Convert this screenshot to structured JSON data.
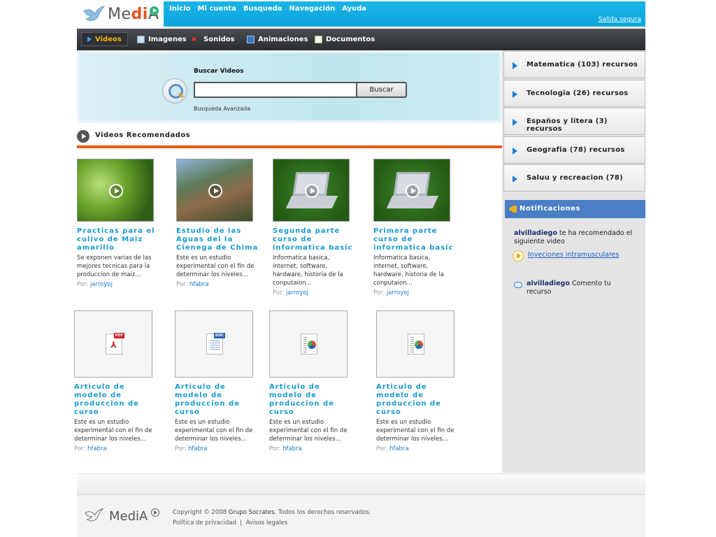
{
  "brand": {
    "name_prefix": "Me",
    "name_accent": "di",
    "name_suffix": "A"
  },
  "topnav": {
    "items": [
      "Inicio",
      "Mi cuenta",
      "Busqueda",
      "Navegación",
      "Ayuda"
    ],
    "logout": "Salida segura",
    "bg_color": "#0aa5dc"
  },
  "media_tabs": [
    {
      "label": "Videos",
      "icon": "play-icon",
      "active": true
    },
    {
      "label": "Imagenes",
      "icon": "image-icon",
      "active": false
    },
    {
      "label": "Sonidos",
      "icon": "speaker-icon",
      "active": false
    },
    {
      "label": "Animaciones",
      "icon": "animation-icon",
      "active": false
    },
    {
      "label": "Documentos",
      "icon": "document-icon",
      "active": false
    }
  ],
  "search": {
    "title": "Buscar Videos",
    "input_value": "",
    "button": "Buscar",
    "advanced": "Busqueda Avanzada"
  },
  "recommended": {
    "title": "Videos Recomendados",
    "accent_color": "#e95b13",
    "by_label": "Por:",
    "videos": [
      {
        "title": "Practicas para el culivo de Maiz amarillo",
        "desc": "Se exponen varias de las mejores tecnicas para la produccion de maiz...",
        "author": "jarroyoj",
        "thumb": "plant"
      },
      {
        "title": "Estudio de las Aguas del la Cienega de Chima",
        "desc": "Este es un estudio experimental con el fin de determinar los niveles...",
        "author": "hfabra",
        "thumb": "people"
      },
      {
        "title": "Segunda parte curso de informatica basic",
        "desc": "Informatica basica, internet, software, hardware, historia de la conputaion...",
        "author": "jarroyoj",
        "thumb": "laptop"
      },
      {
        "title": "Primera parte curso de informatica basic",
        "desc": "Informatica basica, internet, software, hardware, historia de la conputaion...",
        "author": "jarroyoj",
        "thumb": "laptop"
      }
    ],
    "documents": [
      {
        "title": "Articulo de modelo de produccion de curso",
        "desc": "Este es un estudio experimental con el fin de determinar los niveles...",
        "author": "hfabra",
        "icon": "pdf-icon",
        "badge": "PDF"
      },
      {
        "title": "Articulo de modelo de produccion de curso",
        "desc": "Este es un estudio experimental con el fin de determinar los niveles...",
        "author": "hfabra",
        "icon": "word-document-icon",
        "badge": "DOC"
      },
      {
        "title": "Articulo de modelo de produccion de curso",
        "desc": "Este es un estudio experimental con el fin de determinar los niveles...",
        "author": "hfabra",
        "icon": "chart-document-icon",
        "badge": ""
      },
      {
        "title": "Articulo de modelo de produccion de curso",
        "desc": "Este es un estudio experimental con el fin de determinar los niveles...",
        "author": "hfabra",
        "icon": "chart-document-icon",
        "badge": ""
      }
    ]
  },
  "categories": [
    "Matematica (103) recursos",
    "Tecnologia (26) recursos",
    "Españos y litera (3) recursos",
    "Geografia (78) recursos",
    "Saluu y recreacion (78)"
  ],
  "notifications": {
    "title": "Notificaciones",
    "header_color": "#4a7ec5",
    "n1_user": "alvilladiego",
    "n1_text": "te ha recomendado el siguiente video",
    "n1_link": "Inyeciones intramusculares",
    "n2_user": "alvilladiego",
    "n2_text": "Comento tu recurso"
  },
  "footer": {
    "copyright_a": "Copyright © 2008",
    "copyright_org": "Grupo Socrates.",
    "copyright_b": "Todos los derechos reservados.",
    "privacy": "Política de privacidad",
    "separator": "|",
    "legal": "Avisos legales"
  }
}
